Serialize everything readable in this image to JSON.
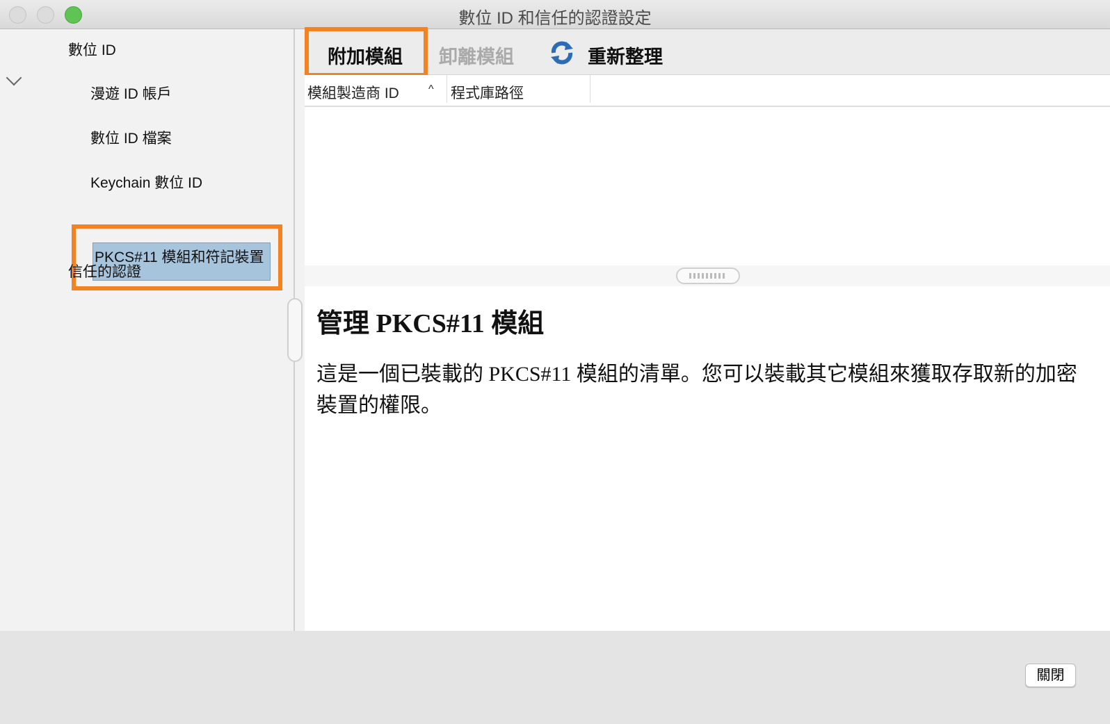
{
  "window": {
    "title": "數位 ID 和信任的認證設定"
  },
  "sidebar": {
    "items": [
      {
        "label": "數位 ID"
      },
      {
        "label": "漫遊 ID 帳戶"
      },
      {
        "label": "數位 ID 檔案"
      },
      {
        "label": "Keychain 數位 ID"
      },
      {
        "label": "PKCS#11 模組和符記裝置"
      },
      {
        "label": "信任的認證"
      }
    ]
  },
  "toolbar": {
    "attach": "附加模組",
    "detach": "卸離模組",
    "refresh": "重新整理"
  },
  "table": {
    "columns": [
      "模組製造商 ID",
      "程式庫路徑"
    ]
  },
  "content": {
    "heading": "管理 PKCS#11 模組",
    "body": "這是一個已裝載的 PKCS#11 模組的清單。您可以裝載其它模組來獲取存取新的加密裝置的權限。"
  },
  "footer": {
    "close": "關閉"
  },
  "colors": {
    "highlight": "#f58220",
    "selection": "#a7c4dd"
  }
}
